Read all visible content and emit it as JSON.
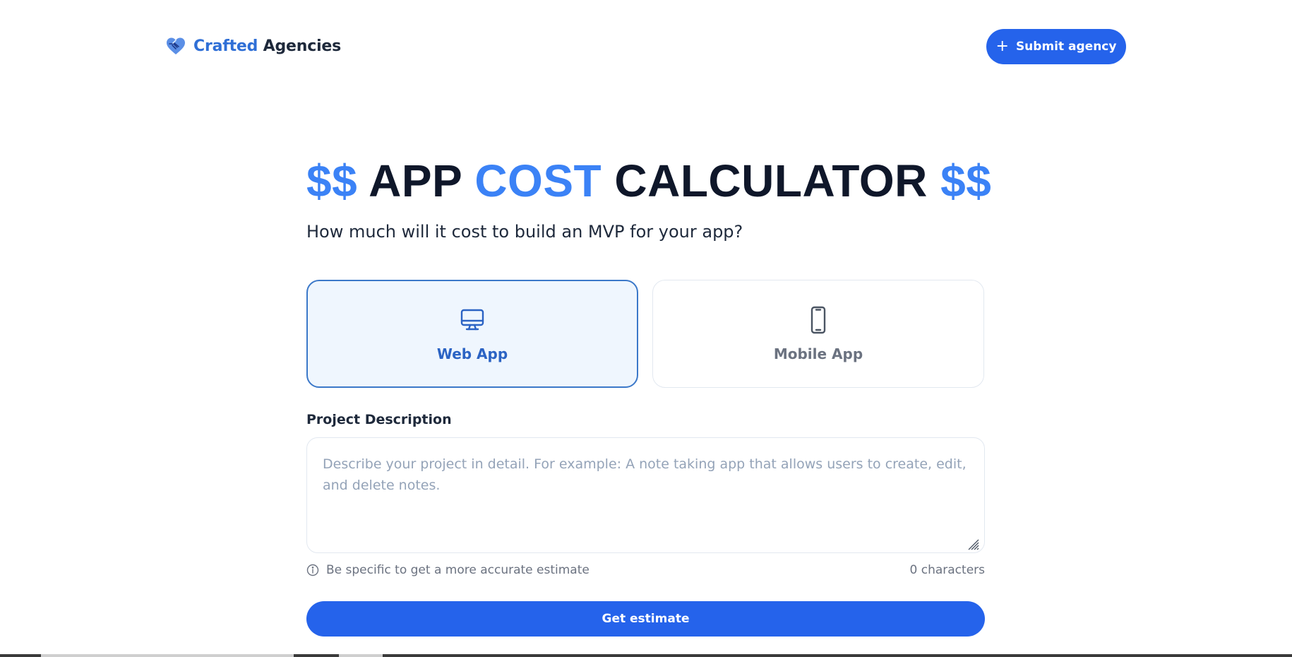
{
  "header": {
    "logo_part1": "Crafted",
    "logo_part2": "Agencies",
    "submit_label": "Submit agency"
  },
  "hero": {
    "title_dollars_left": "$$",
    "title_app": "APP",
    "title_cost": "COST",
    "title_calculator": "CALCULATOR",
    "title_dollars_right": "$$",
    "subtitle": "How much will it cost to build an MVP for your app?"
  },
  "options": [
    {
      "label": "Web App",
      "icon": "monitor-icon",
      "selected": true
    },
    {
      "label": "Mobile App",
      "icon": "smartphone-icon",
      "selected": false
    }
  ],
  "description": {
    "label": "Project Description",
    "placeholder": "Describe your project in detail. For example: A note taking app that allows users to create, edit, and delete notes.",
    "value": "",
    "hint": "Be specific to get a more accurate estimate",
    "char_count": "0 characters"
  },
  "cta": {
    "label": "Get estimate"
  },
  "colors": {
    "primary": "#2563eb",
    "accent": "#3b82f6",
    "selected_border": "#3b78c9",
    "selected_bg": "#eff6fe",
    "text_dark": "#0f172a",
    "muted": "#6b7280"
  }
}
